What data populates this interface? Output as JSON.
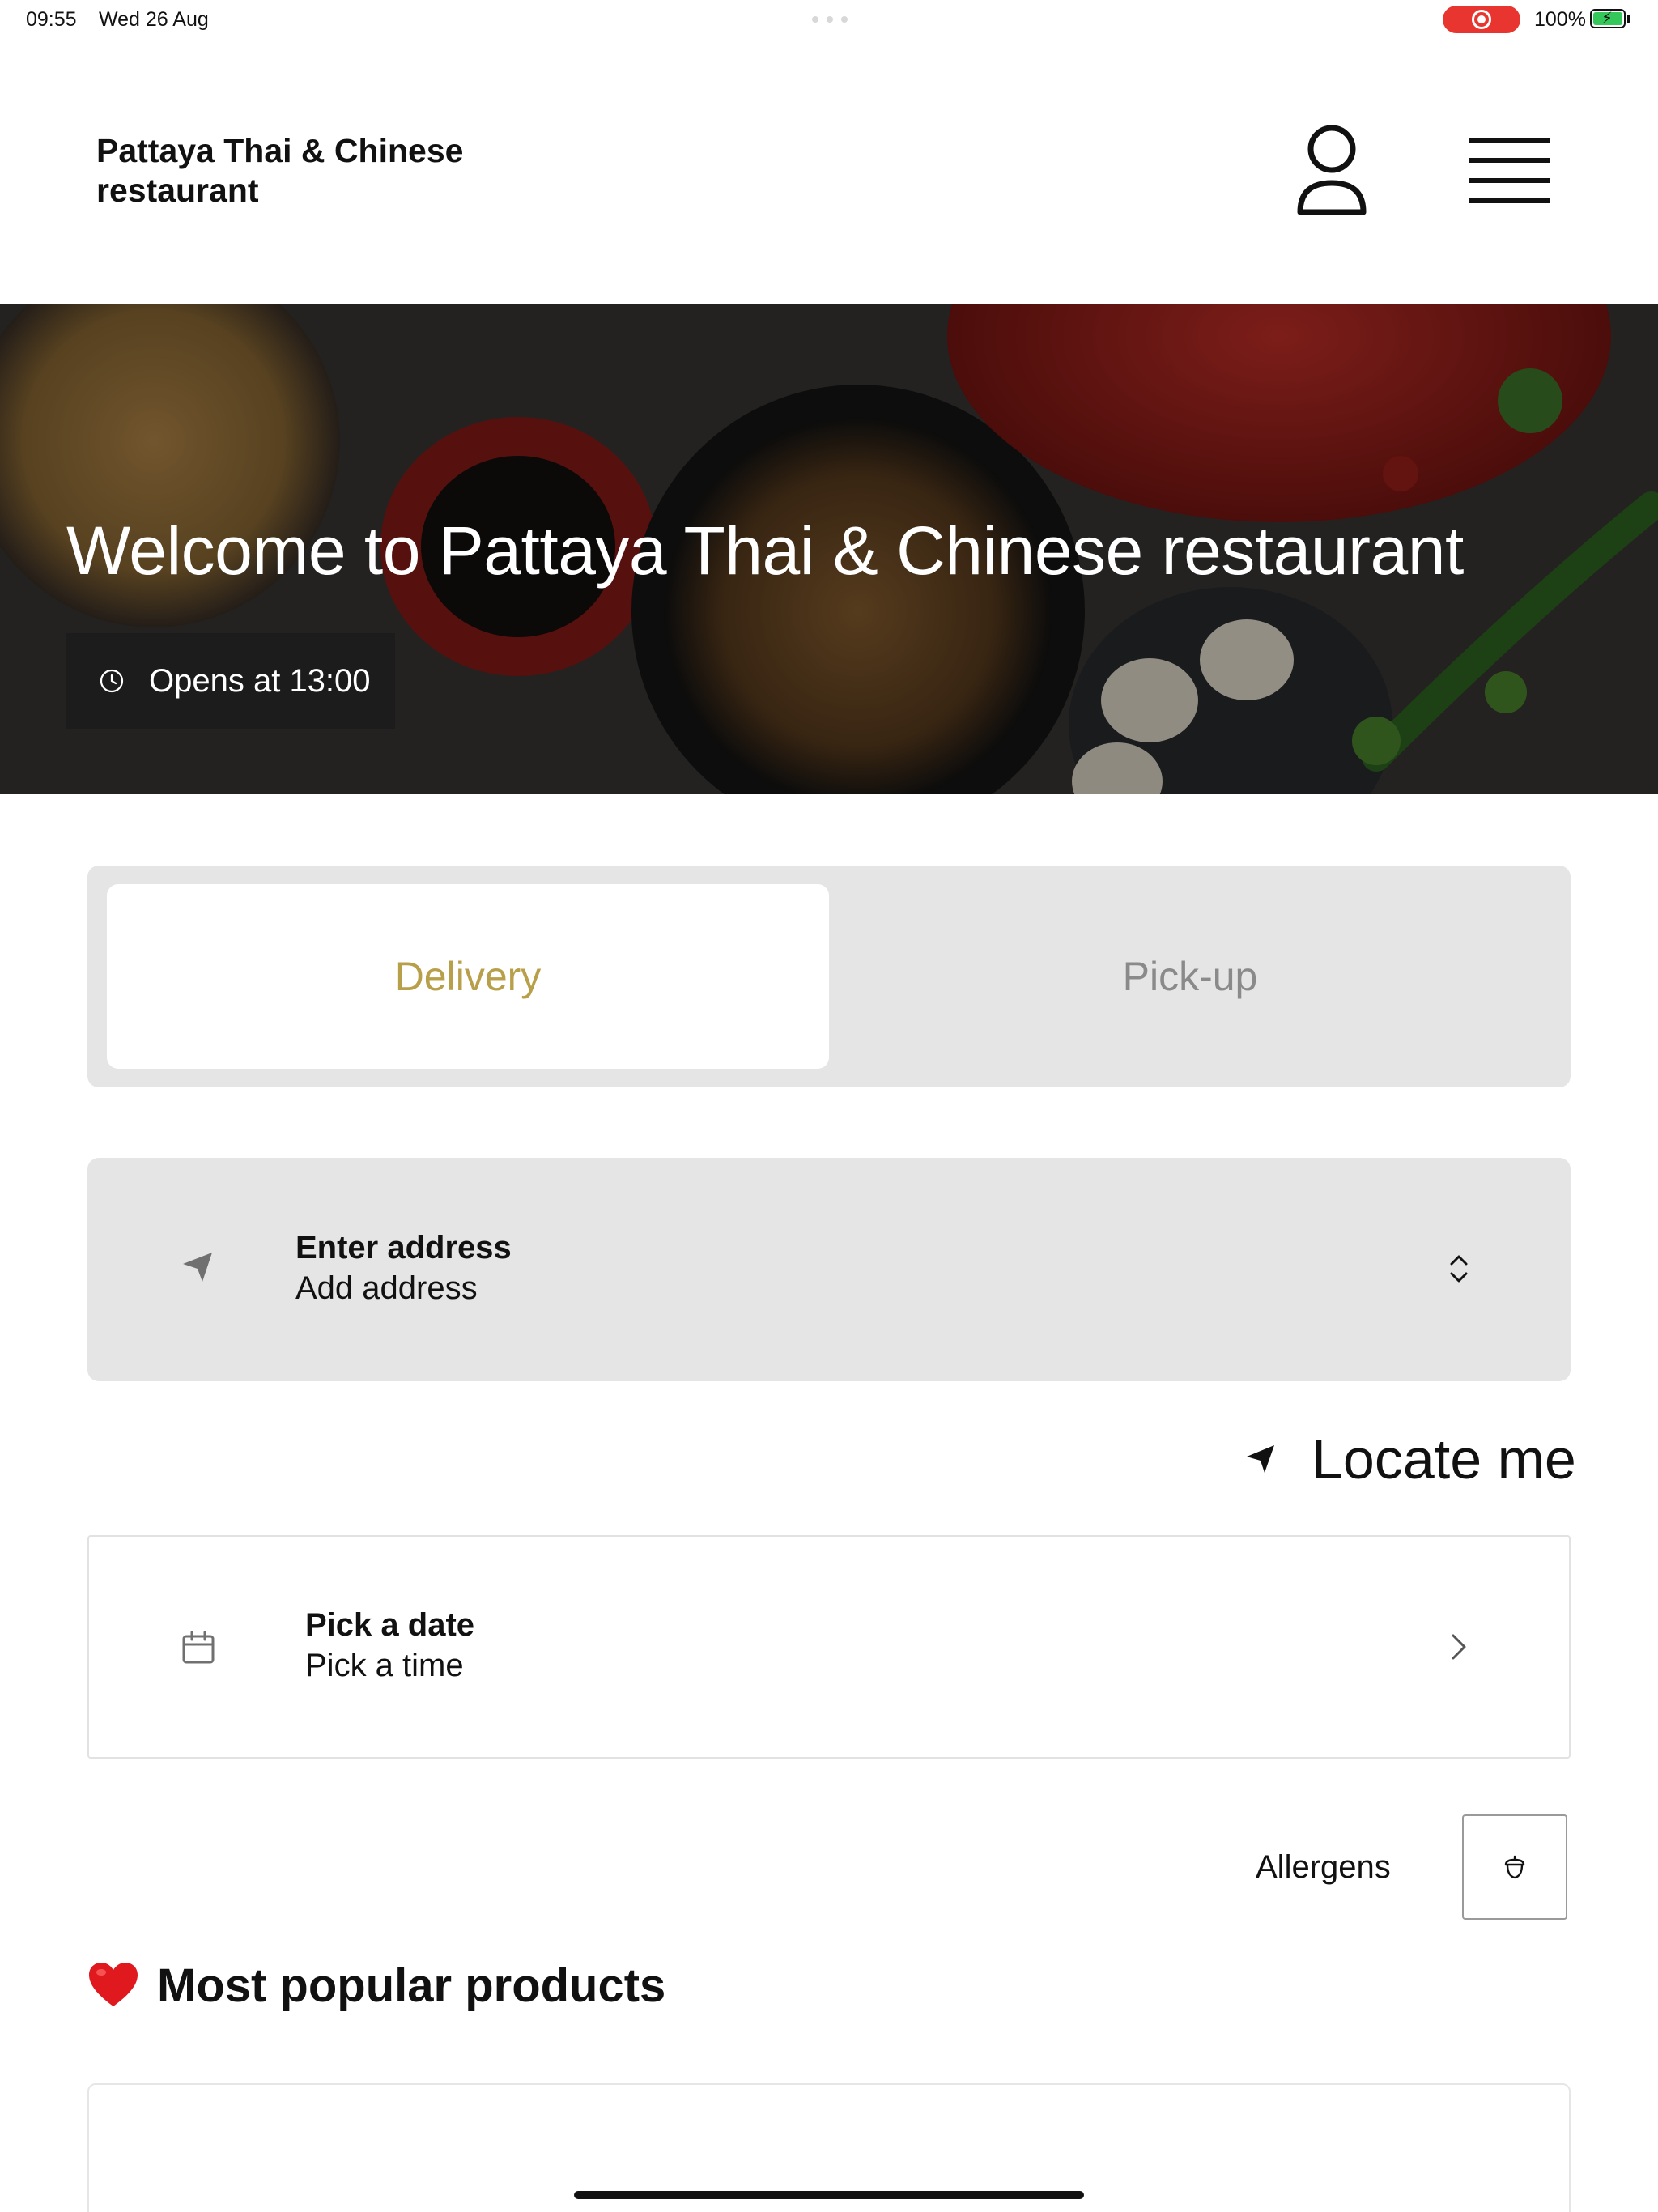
{
  "status_bar": {
    "time": "09:55",
    "date": "Wed 26 Aug",
    "battery": "100%"
  },
  "header": {
    "title": "Pattaya Thai & Chinese restaurant",
    "user_icon": "user-icon",
    "menu_icon": "menu-icon"
  },
  "hero": {
    "title": "Welcome to Pattaya Thai & Chinese restaurant",
    "opens_text": "Opens at 13:00",
    "clock_icon": "clock-icon"
  },
  "order_mode": {
    "options": [
      "Delivery",
      "Pick-up"
    ],
    "selected": "Delivery",
    "accent_color": "#b8a04a"
  },
  "address": {
    "title": "Enter address",
    "subtitle": "Add address",
    "icon": "location-arrow-icon"
  },
  "locate": {
    "label": "Locate me"
  },
  "schedule": {
    "title": "Pick a date",
    "subtitle": "Pick a time",
    "icon": "calendar-icon"
  },
  "allergens": {
    "label": "Allergens",
    "icon": "acorn-icon"
  },
  "popular": {
    "heading": "Most popular products",
    "icon": "heart-icon"
  },
  "colors": {
    "segment_bg": "#e5e5e5",
    "hero_badge": "#1c1c1c",
    "record_pill": "#e8352f",
    "battery_fill": "#34c759"
  }
}
